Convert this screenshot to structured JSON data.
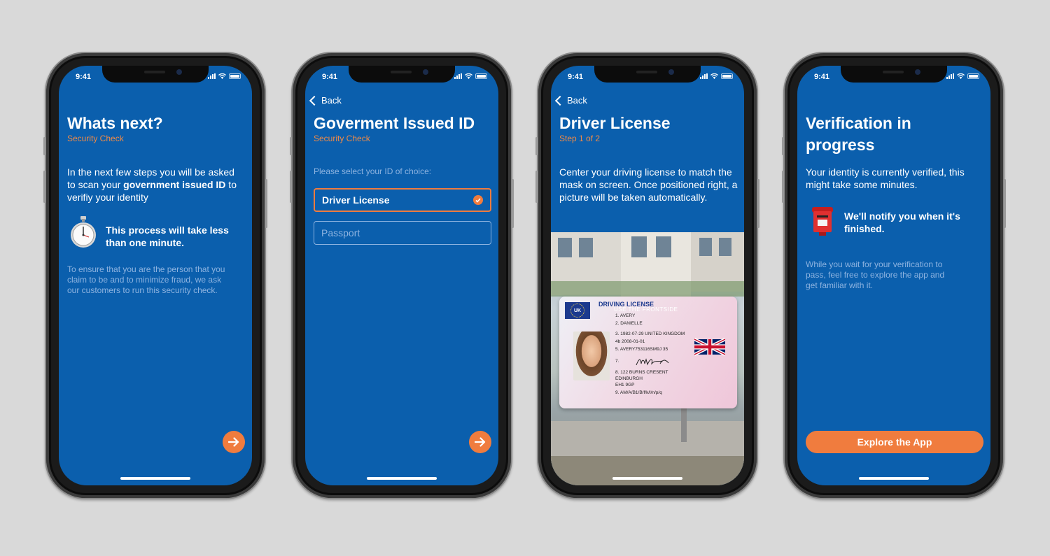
{
  "status": {
    "time": "9:41"
  },
  "screens": [
    {
      "title": "Whats next?",
      "subtitle": "Security Check",
      "intro_1": "In the next few steps you will be asked to scan your ",
      "intro_bold": "government issued ID",
      "intro_2": " to verifiy your identity",
      "highlight": "This process will take less than one minute.",
      "highlight_icon": "stopwatch-icon",
      "note": "To ensure that you are the person that you claim to be and to minimize fraud, we ask our customers to run this security check."
    },
    {
      "back_label": "Back",
      "title": "Goverment Issued ID",
      "subtitle": "Security Check",
      "prompt": "Please select your ID of choice:",
      "options": [
        {
          "label": "Driver License",
          "selected": true
        },
        {
          "label": "Passport",
          "selected": false
        }
      ]
    },
    {
      "back_label": "Back",
      "title": "Driver License",
      "subtitle": "Step 1 of 2",
      "instructions": "Center your driving license to match the mask on screen. Once positioned right, a picture will be taken automatically.",
      "license": {
        "country": "UK",
        "heading": "DRIVING LICENSE",
        "watermark": "USE THE FRONTSIDE",
        "fields": [
          "1.   AVERY",
          "2.   DANIELLE",
          "3.   1982-07-29 UNITED KINGDOM",
          "4b  2008-01-01",
          "5.          AVERY753116SM9J 35",
          "7.",
          "8.   122 BURNS CRESENT",
          "      EDINBURGH",
          "      EH1 9GP",
          "9.   AM/A/B1/B/f/k/l/n/p/q"
        ]
      }
    },
    {
      "title": "Verification in progress",
      "status": "Your identity is currently verified, this might take some minutes.",
      "notify": "We'll notify you when it's finished.",
      "notify_icon": "postbox-icon",
      "note": "While you wait for your verification to pass, feel free to explore the app and get familiar with it.",
      "cta_label": "Explore the App"
    }
  ],
  "colors": {
    "screen_bg": "#0b5fad",
    "accent": "#f07c3e",
    "muted_text": "#8db3e0"
  }
}
